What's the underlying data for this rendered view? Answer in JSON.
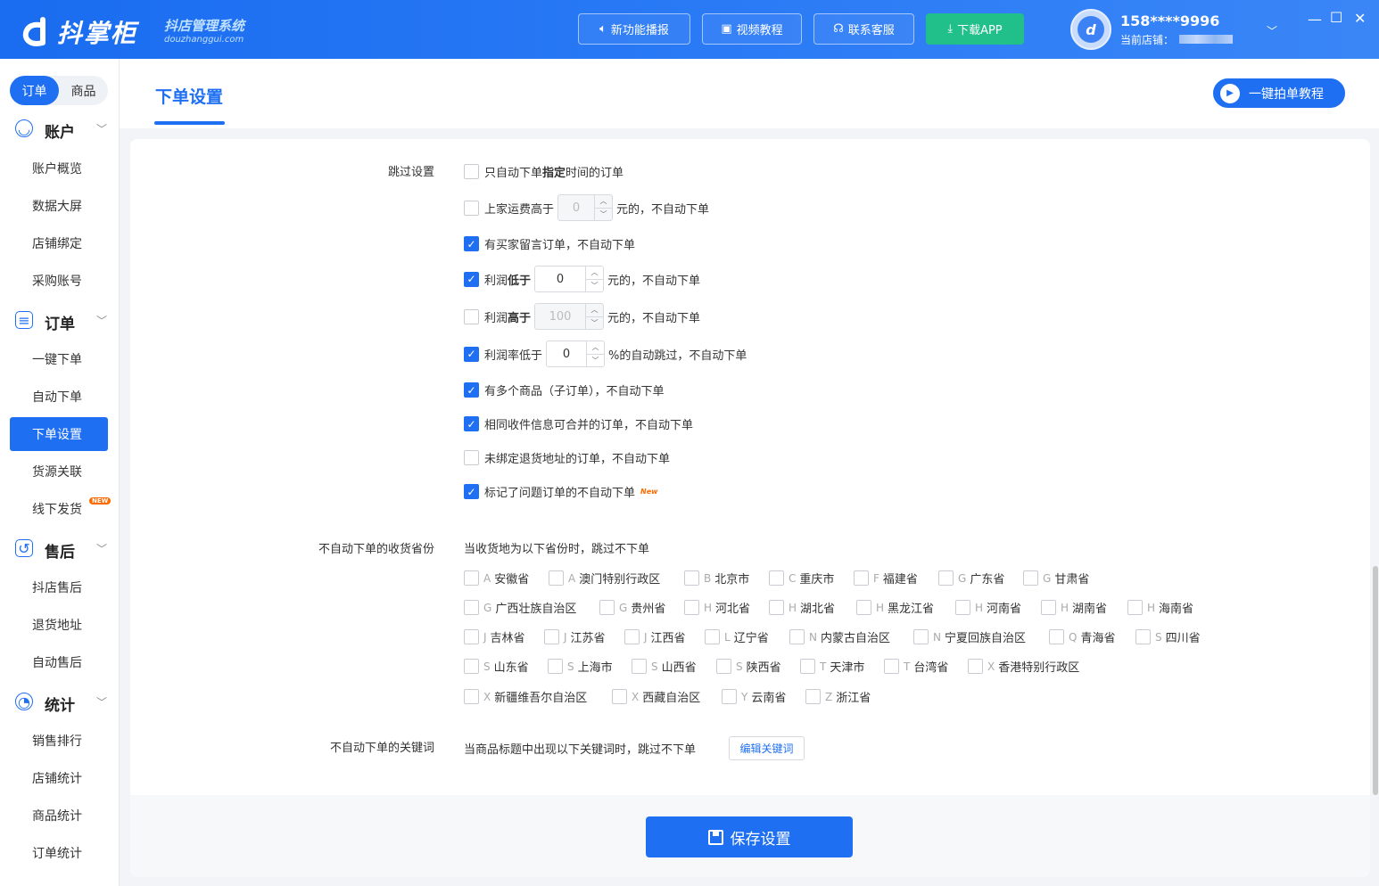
{
  "app": {
    "name": "抖掌柜",
    "subtitle_cn": "抖店管理系统",
    "subtitle_en": "douzhanggui.com"
  },
  "topbar": {
    "buttons": [
      {
        "label": "新功能播报",
        "icon": "speaker-icon"
      },
      {
        "label": "视频教程",
        "icon": "video-icon"
      },
      {
        "label": "联系客服",
        "icon": "headset-icon"
      },
      {
        "label": "下载APP",
        "icon": "download-icon"
      }
    ],
    "user": {
      "phone": "158****9996",
      "shop_label": "当前店铺："
    },
    "window": {
      "minimize": "—",
      "maximize": "☐",
      "close": "✕"
    }
  },
  "sidebar": {
    "tabs": [
      "订单",
      "商品"
    ],
    "groups": [
      {
        "label": "账户",
        "icon": "account-icon",
        "items": [
          "账户概览",
          "数据大屏",
          "店铺绑定",
          "采购账号"
        ]
      },
      {
        "label": "订单",
        "icon": "order-icon",
        "items": [
          "一键下单",
          "自动下单",
          "下单设置",
          "货源关联",
          "线下发货"
        ]
      },
      {
        "label": "售后",
        "icon": "aftersale-icon",
        "items": [
          "抖店售后",
          "退货地址",
          "自动售后"
        ]
      },
      {
        "label": "统计",
        "icon": "stats-icon",
        "items": [
          "销售排行",
          "店铺统计",
          "商品统计",
          "订单统计"
        ]
      }
    ],
    "active_item": "下单设置",
    "new_badge": "NEW"
  },
  "header": {
    "title": "下单设置",
    "tutorial_button": "一键拍单教程"
  },
  "skip_settings": {
    "label": "跳过设置",
    "options": [
      {
        "parts": [
          "只自动下单 ",
          "指定",
          " 时间的订单"
        ],
        "checked": false
      },
      {
        "before": "上家运费高于",
        "value": "0",
        "after": "元的，不自动下单",
        "checked": false,
        "disabled": true
      },
      {
        "text": "有买家留言订单，不自动下单",
        "checked": true
      },
      {
        "before_a": "利润",
        "before_b": "低于",
        "value": "0",
        "after": "元的，不自动下单",
        "checked": true
      },
      {
        "before_a": "利润",
        "before_b": "高于",
        "value": "100",
        "after": "元的，不自动下单",
        "checked": false,
        "disabled": true
      },
      {
        "before": "利润率低于",
        "value": "0",
        "after": "%的自动跳过，不自动下单",
        "checked": true
      },
      {
        "text": "有多个商品（子订单），不自动下单",
        "checked": true
      },
      {
        "text": "相同收件信息可合并的订单，不自动下单",
        "checked": true
      },
      {
        "text": "未绑定退货地址的订单，不自动下单",
        "checked": false
      },
      {
        "text": "标记了问题订单的不自动下单",
        "checked": true,
        "badge": "New"
      }
    ]
  },
  "province_settings": {
    "label": "不自动下单的收货省份",
    "hint": "当收货地为以下省份时，跳过不下单",
    "rows": [
      [
        [
          "A",
          "安徽省"
        ],
        [
          "A",
          "澳门特别行政区"
        ],
        [
          "B",
          "北京市"
        ],
        [
          "C",
          "重庆市"
        ],
        [
          "F",
          "福建省"
        ],
        [
          "G",
          "广东省"
        ],
        [
          "G",
          "甘肃省"
        ]
      ],
      [
        [
          "G",
          "广西壮族自治区"
        ],
        [
          "G",
          "贵州省"
        ],
        [
          "H",
          "河北省"
        ],
        [
          "H",
          "湖北省"
        ],
        [
          "H",
          "黑龙江省"
        ],
        [
          "H",
          "河南省"
        ],
        [
          "H",
          "湖南省"
        ],
        [
          "H",
          "海南省"
        ]
      ],
      [
        [
          "J",
          "吉林省"
        ],
        [
          "J",
          "江苏省"
        ],
        [
          "J",
          "江西省"
        ],
        [
          "L",
          "辽宁省"
        ],
        [
          "N",
          "内蒙古自治区"
        ],
        [
          "N",
          "宁夏回族自治区"
        ],
        [
          "Q",
          "青海省"
        ],
        [
          "S",
          "四川省"
        ]
      ],
      [
        [
          "S",
          "山东省"
        ],
        [
          "S",
          "上海市"
        ],
        [
          "S",
          "山西省"
        ],
        [
          "S",
          "陕西省"
        ],
        [
          "T",
          "天津市"
        ],
        [
          "T",
          "台湾省"
        ],
        [
          "X",
          "香港特别行政区"
        ]
      ],
      [
        [
          "X",
          "新疆维吾尔自治区"
        ],
        [
          "X",
          "西藏自治区"
        ],
        [
          "Y",
          "云南省"
        ],
        [
          "Z",
          "浙江省"
        ]
      ]
    ]
  },
  "keyword_settings": {
    "label": "不自动下单的关键词",
    "hint": "当商品标题中出现以下关键词时，跳过不下单",
    "edit_button": "编辑关键词"
  },
  "footer": {
    "save_button": "保存设置"
  },
  "colors": {
    "primary": "#1e6ff2",
    "green": "#21c08b",
    "badge": "#ff6a00"
  }
}
